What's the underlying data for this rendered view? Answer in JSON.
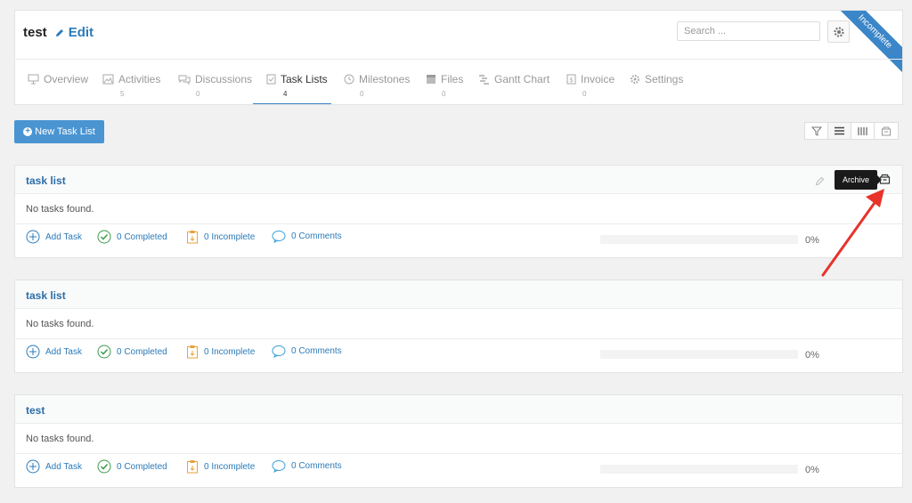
{
  "project": {
    "title": "test",
    "edit_label": "Edit",
    "status_ribbon": "Incomplete"
  },
  "search": {
    "placeholder": "Search ..."
  },
  "tabs": [
    {
      "label": "Overview",
      "count": ""
    },
    {
      "label": "Activities",
      "count": "5"
    },
    {
      "label": "Discussions",
      "count": "0"
    },
    {
      "label": "Task Lists",
      "count": "4"
    },
    {
      "label": "Milestones",
      "count": "0"
    },
    {
      "label": "Files",
      "count": "0"
    },
    {
      "label": "Gantt Chart",
      "count": ""
    },
    {
      "label": "Invoice",
      "count": "0"
    },
    {
      "label": "Settings",
      "count": ""
    }
  ],
  "toolbar": {
    "new_list_label": "New Task List"
  },
  "tooltip": {
    "archive": "Archive"
  },
  "colors": {
    "accent": "#3a86c8",
    "link": "#2b7bb9",
    "arrow": "#e8332a"
  },
  "task_lists": [
    {
      "title": "task list",
      "empty_text": "No tasks found.",
      "add_task": "Add Task",
      "completed": "0 Completed",
      "incomplete": "0 Incomplete",
      "comments": "0 Comments",
      "progress": "0%"
    },
    {
      "title": "task list",
      "empty_text": "No tasks found.",
      "add_task": "Add Task",
      "completed": "0 Completed",
      "incomplete": "0 Incomplete",
      "comments": "0 Comments",
      "progress": "0%"
    },
    {
      "title": "test",
      "empty_text": "No tasks found.",
      "add_task": "Add Task",
      "completed": "0 Completed",
      "incomplete": "0 Incomplete",
      "comments": "0 Comments",
      "progress": "0%"
    }
  ]
}
